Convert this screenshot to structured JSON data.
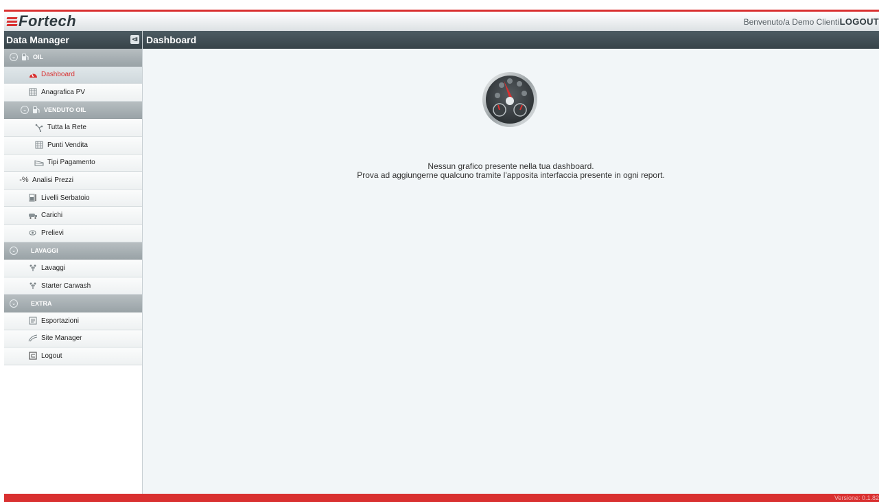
{
  "header": {
    "brand": "Fortech",
    "welcome": "Benvenuto/a Demo Clienti",
    "logout": "LOGOUT"
  },
  "sidebar": {
    "title": "Data Manager",
    "collapse_icon": "collapse-left-icon",
    "items": [
      {
        "label": "OIL",
        "icon": "fuel-pump-icon",
        "type": "section"
      },
      {
        "label": "Dashboard",
        "icon": "speedometer-icon",
        "type": "item",
        "active": true
      },
      {
        "label": "Anagrafica PV",
        "icon": "calendar-grid-icon",
        "type": "item"
      },
      {
        "label": "VENDUTO OIL",
        "icon": "fuel-pump-icon",
        "type": "subsection"
      },
      {
        "label": "Tutta la Rete",
        "icon": "network-icon",
        "type": "subitem"
      },
      {
        "label": "Punti Vendita",
        "icon": "calendar-grid-icon",
        "type": "subitem"
      },
      {
        "label": "Tipi Pagamento",
        "icon": "card-icon",
        "type": "subitem"
      },
      {
        "label": "Analisi Prezzi",
        "icon": "percent-icon",
        "type": "item"
      },
      {
        "label": "Livelli Serbatoio",
        "icon": "tank-level-icon",
        "type": "item"
      },
      {
        "label": "Carichi",
        "icon": "truck-icon",
        "type": "item"
      },
      {
        "label": "Prelievi",
        "icon": "nozzle-icon",
        "type": "item"
      },
      {
        "label": "LAVAGGI",
        "icon": "",
        "type": "section"
      },
      {
        "label": "Lavaggi",
        "icon": "carwash-icon",
        "type": "item"
      },
      {
        "label": "Starter Carwash",
        "icon": "carwash-icon",
        "type": "item"
      },
      {
        "label": "EXTRA",
        "icon": "",
        "type": "section"
      },
      {
        "label": "Esportazioni",
        "icon": "export-icon",
        "type": "item"
      },
      {
        "label": "Site Manager",
        "icon": "site-manager-icon",
        "type": "item"
      },
      {
        "label": "Logout",
        "icon": "logout-icon",
        "type": "item"
      }
    ]
  },
  "main": {
    "title": "Dashboard",
    "gauge_icon": "dashboard-gauge-icon",
    "empty_line1": "Nessun grafico presente nella tua dashboard.",
    "empty_line2": "Prova ad aggiungerne qualcuno tramite l'apposita interfaccia presente in ogni report."
  },
  "footer": {
    "version": "Versione: 0.1.82"
  },
  "colors": {
    "accent": "#d93030",
    "header_dark": "#3f4b52",
    "section_gray": "#a6aeb2"
  }
}
